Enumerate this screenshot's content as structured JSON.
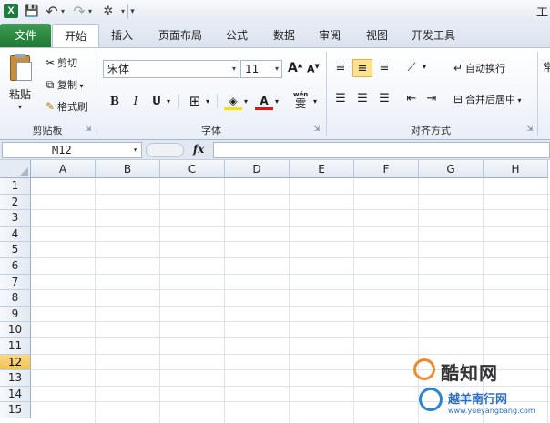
{
  "title_fragment": "工",
  "qat": {
    "logo": "X",
    "save": "💾",
    "undo": "↶",
    "redo": "↷",
    "customize": "▾"
  },
  "tabs": [
    "文件",
    "开始",
    "插入",
    "页面布局",
    "公式",
    "数据",
    "审阅",
    "视图",
    "开发工具"
  ],
  "clipboard": {
    "paste": "粘贴",
    "cut": "剪切",
    "copy": "复制",
    "format_painter": "格式刷",
    "group": "剪贴板"
  },
  "font": {
    "name": "宋体",
    "size": "11",
    "grow": "A",
    "shrink": "A",
    "bold": "B",
    "italic": "I",
    "underline": "U",
    "border": "⊞",
    "fill": "◈",
    "color": "A",
    "phonetic": "wén",
    "phonetic_char": "雯",
    "group": "字体"
  },
  "alignment": {
    "wrap": "自动换行",
    "merge": "合并后居中",
    "group": "对齐方式"
  },
  "number_frag": "常",
  "formula_bar": {
    "name_box": "M12",
    "fx": "fx",
    "value": ""
  },
  "columns": [
    "A",
    "B",
    "C",
    "D",
    "E",
    "F",
    "G",
    "H"
  ],
  "rows": [
    "1",
    "2",
    "3",
    "4",
    "5",
    "6",
    "7",
    "8",
    "9",
    "10",
    "11",
    "12",
    "13",
    "14",
    "15"
  ],
  "selected_row": "12",
  "watermark": {
    "line1": "酷知网",
    "line2": "越羊南行网",
    "url": "www.yueyangbang.com"
  },
  "colors": {
    "file_tab": "#1f7a35",
    "selected_row": "#f2c24f",
    "align_selected": "#fde28e"
  }
}
